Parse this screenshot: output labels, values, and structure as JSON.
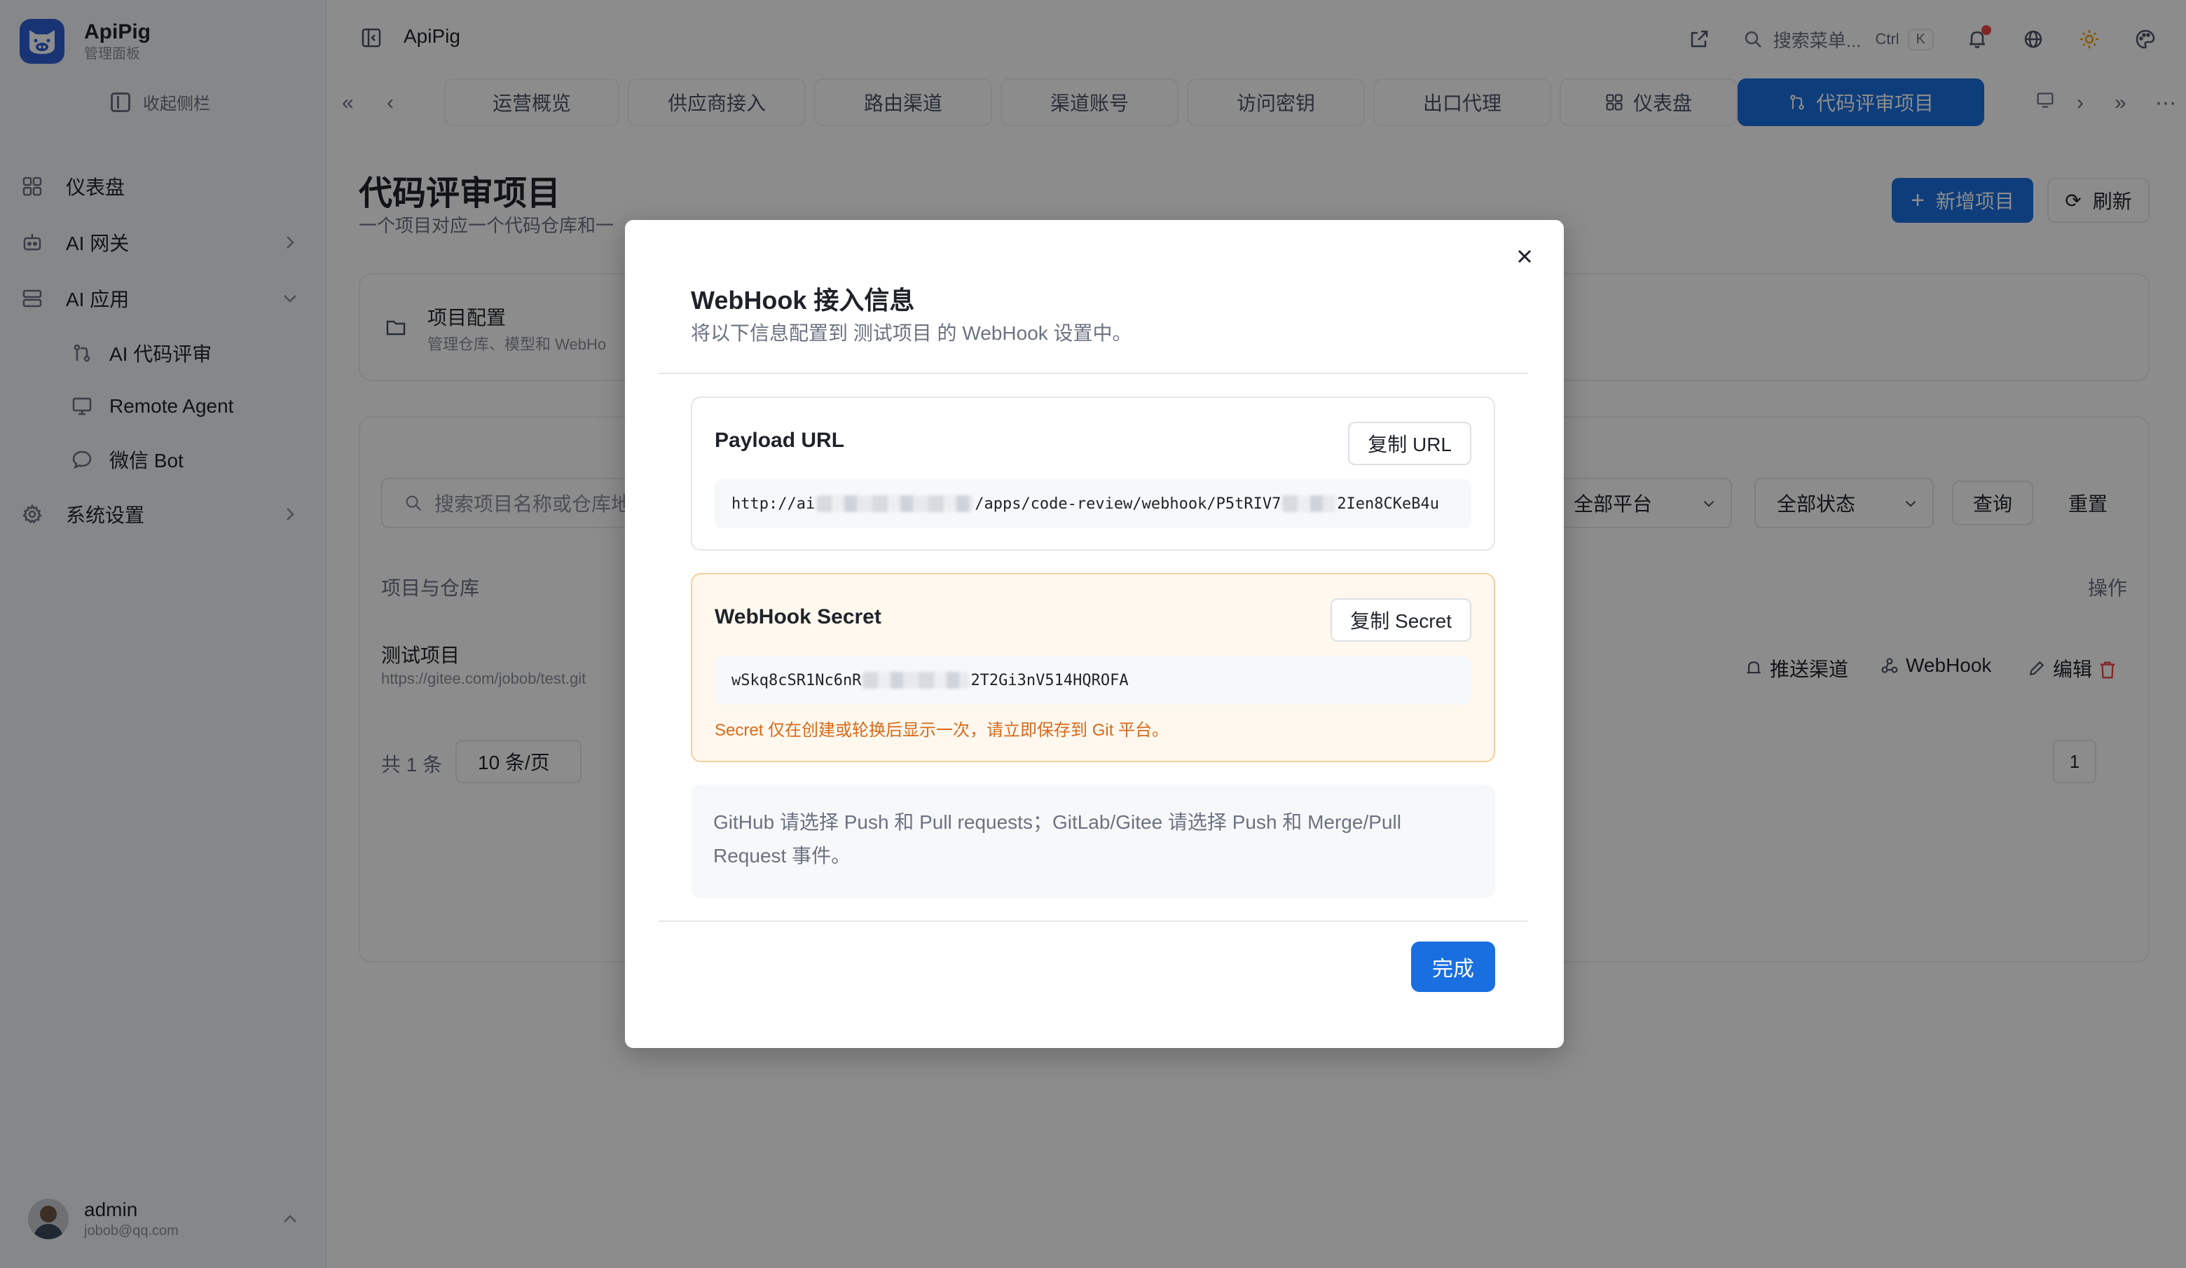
{
  "app": {
    "brand_name": "ApiPig",
    "brand_sub": "管理面板",
    "header_title": "ApiPig",
    "search_placeholder": "搜索菜单...",
    "search_kbd": "Ctrl",
    "search_kbd_key": "K"
  },
  "sidebar": {
    "collapse_label": "收起侧栏",
    "items": [
      {
        "label": "仪表盘",
        "icon": "dashboard-icon"
      },
      {
        "label": "AI 网关",
        "icon": "gateway-icon"
      },
      {
        "label": "AI 应用",
        "icon": "apps-icon"
      },
      {
        "label": "AI 代码评审",
        "icon": "code-review-icon"
      },
      {
        "label": "Remote Agent",
        "icon": "remote-agent-icon"
      },
      {
        "label": "微信 Bot",
        "icon": "chat-bubble-icon"
      },
      {
        "label": "系统设置",
        "icon": "gear-icon"
      }
    ]
  },
  "user": {
    "name": "admin",
    "email": "jobob@qq.com"
  },
  "tabs": [
    {
      "label": "运营概览"
    },
    {
      "label": "供应商接入"
    },
    {
      "label": "路由渠道"
    },
    {
      "label": "渠道账号"
    },
    {
      "label": "访问密钥"
    },
    {
      "label": "出口代理"
    },
    {
      "label": "仪表盘"
    },
    {
      "label": "代码评审项目"
    }
  ],
  "page": {
    "title": "代码评审项目",
    "desc": "一个项目对应一个代码仓库和一",
    "new_button": "新增项目",
    "refresh_button": "刷新",
    "config_title": "项目配置",
    "config_desc": "管理仓库、模型和 WebHo",
    "search_placeholder": "搜索项目名称或仓库地",
    "platform_select": "全部平台",
    "status_select": "全部状态",
    "query_button": "查询",
    "reset_button": "重置",
    "col_project": "项目与仓库",
    "col_actions": "操作",
    "row_name": "测试项目",
    "row_repo": "https://gitee.com/jobob/test.git",
    "action_push": "推送渠道",
    "action_webhook": "WebHook",
    "action_edit": "编辑",
    "total": "共 1 条",
    "page_size": "10 条/页",
    "page_num": "1"
  },
  "modal": {
    "title": "WebHook 接入信息",
    "subtitle": "将以下信息配置到 测试项目 的 WebHook 设置中。",
    "url_label": "Payload URL",
    "url_copy": "复制 URL",
    "url_prefix": "http://ai",
    "url_suffix": "/apps/code-review/webhook/P5tRIV7",
    "url_tail": "2Ien8CKeB4u",
    "secret_label": "WebHook Secret",
    "secret_copy": "复制 Secret",
    "secret_prefix": "wSkq8cSR1Nc6nR",
    "secret_tail": "2T2Gi3nV514HQROFA",
    "secret_note": "Secret 仅在创建或轮换后显示一次，请立即保存到 Git 平台。",
    "hint": "GitHub 请选择 Push 和 Pull requests；GitLab/Gitee 请选择 Push 和 Merge/Pull Request 事件。",
    "done": "完成"
  },
  "colors": {
    "accent": "#1a6fe0",
    "warning_text": "#d9691a",
    "warning_border": "#f5cf9d",
    "danger": "#ef4444"
  }
}
